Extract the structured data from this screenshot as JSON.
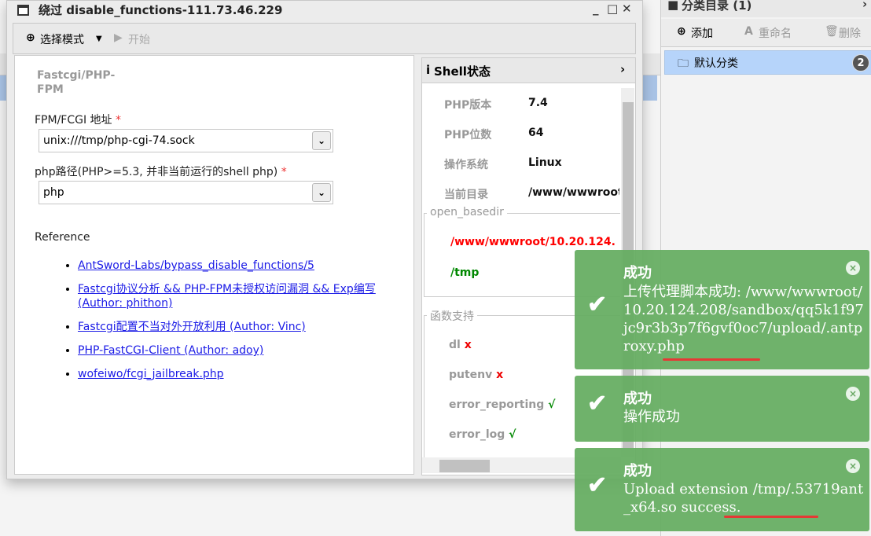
{
  "window": {
    "title": "绕过 disable_functions-111.73.46.229",
    "controls": [
      "_",
      "□",
      "✕"
    ]
  },
  "toolbar": {
    "select_mode": "选择模式",
    "start": "开始"
  },
  "form": {
    "group_title": "Fastcgi/PHP-FPM",
    "fpm_label": "FPM/FCGI 地址",
    "fpm_value": "unix:///tmp/php-cgi-74.sock",
    "php_label": "php路径(PHP>=5.3, 并非当前运行的shell php)",
    "php_value": "php",
    "required_mark": "*",
    "reference_label": "Reference",
    "references": [
      "AntSword-Labs/bypass_disable_functions/5",
      "Fastcgi协议分析 && PHP-FPM未授权访问漏洞 && Exp编写(Author: phithon)",
      "Fastcgi配置不当对外开放利用 (Author: Vinc)",
      "PHP-FastCGI-Client (Author: adoy)",
      "wofeiwo/fcgi_jailbreak.php"
    ]
  },
  "shell_status": {
    "title": "Shell状态",
    "rows": [
      {
        "key": "PHP版本",
        "value": "7.4"
      },
      {
        "key": "PHP位数",
        "value": "64"
      },
      {
        "key": "操作系统",
        "value": "Linux"
      },
      {
        "key": "当前目录",
        "value": "/www/wwwroot"
      }
    ],
    "open_basedir_label": "open_basedir",
    "open_basedir": [
      {
        "path": "/www/wwwroot/10.20.124.",
        "color": "#ff0000"
      },
      {
        "path": "/tmp",
        "color": "#008000"
      }
    ],
    "functions_label": "函数支持",
    "functions": [
      {
        "name": "dl",
        "mark": "x",
        "supported": false
      },
      {
        "name": "putenv",
        "mark": "x",
        "supported": false
      },
      {
        "name": "error_reporting",
        "mark": "√",
        "supported": true
      },
      {
        "name": "error_log",
        "mark": "√",
        "supported": true
      }
    ]
  },
  "category": {
    "title": "分类目录 (1)",
    "add": "添加",
    "rename": "重命名",
    "delete": "删除",
    "items": [
      {
        "label": "默认分类",
        "count": "2"
      }
    ]
  },
  "toasts": [
    {
      "title": "成功",
      "message": "上传代理脚本成功: /www/wwwroot/10.20.124.208/sandbox/qq5k1f97jc9r3b3p7f6gvf0oc7/upload/.antproxy.php"
    },
    {
      "title": "成功",
      "message": "操作成功"
    },
    {
      "title": "成功",
      "message": "Upload extension /tmp/.53719ant_x64.so success."
    }
  ],
  "colors": {
    "toast_bg": "#6cae68",
    "selected": "#b6d4fa",
    "link": "#1a1ae6",
    "error": "#ff0000",
    "ok": "#008000",
    "annotation": "#e53935"
  }
}
